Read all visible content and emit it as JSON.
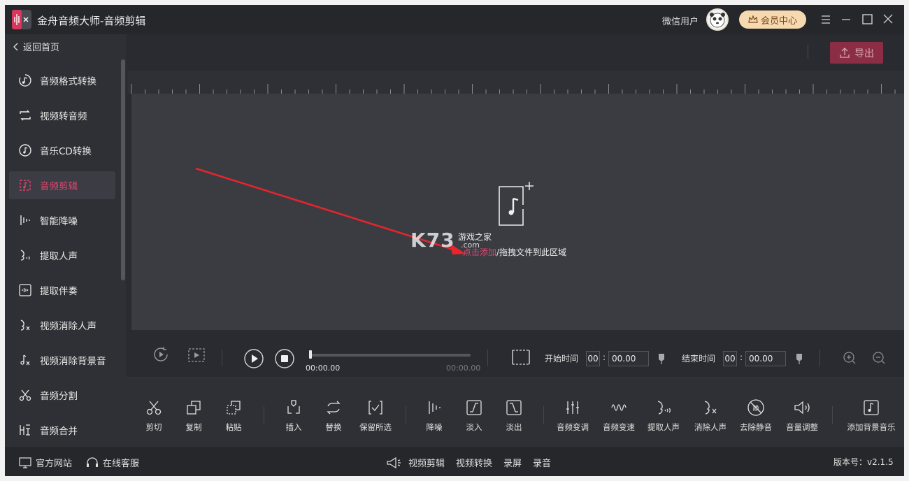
{
  "app": {
    "title": "金舟音频大师-音频剪辑"
  },
  "header": {
    "user_name": "微信用户",
    "vip_label": "会员中心"
  },
  "sidebar": {
    "back_label": "返回首页",
    "items": [
      {
        "label": "音频格式转换",
        "icon": "audio-convert-icon"
      },
      {
        "label": "视频转音频",
        "icon": "video-to-audio-icon"
      },
      {
        "label": "音乐CD转换",
        "icon": "cd-icon"
      },
      {
        "label": "音频剪辑",
        "icon": "audio-edit-icon",
        "active": true
      },
      {
        "label": "智能降噪",
        "icon": "denoise-icon"
      },
      {
        "label": "提取人声",
        "icon": "voice-extract-icon"
      },
      {
        "label": "提取伴奏",
        "icon": "accompaniment-icon"
      },
      {
        "label": "视频消除人声",
        "icon": "video-remove-voice-icon"
      },
      {
        "label": "视频消除背景音",
        "icon": "video-remove-bgm-icon"
      },
      {
        "label": "音频分割",
        "icon": "split-icon"
      },
      {
        "label": "音频合并",
        "icon": "merge-icon"
      }
    ]
  },
  "toolbar": {
    "export_label": "导出"
  },
  "canvas": {
    "add_link": "点击添加",
    "drop_text": "/拖拽文件到此区域",
    "watermark": "K73",
    "watermark_cn": "游戏之家",
    "watermark_com": ".com"
  },
  "playback": {
    "current_time": "00:00.00",
    "total_time": "00:00.00",
    "progress": 0,
    "start_label": "开始时间",
    "start_min": "00",
    "start_sec": "00.00",
    "end_label": "结束时间",
    "end_min": "00",
    "end_sec": "00.00",
    "colon": ":"
  },
  "tools": [
    {
      "label": "剪切",
      "icon": "scissors-icon"
    },
    {
      "label": "复制",
      "icon": "copy-icon"
    },
    {
      "label": "粘贴",
      "icon": "paste-icon"
    },
    {
      "label": "插入",
      "icon": "insert-icon"
    },
    {
      "label": "替换",
      "icon": "replace-icon"
    },
    {
      "label": "保留所选",
      "icon": "keep-selection-icon"
    },
    {
      "label": "降噪",
      "icon": "noise-reduction-icon"
    },
    {
      "label": "淡入",
      "icon": "fade-in-icon"
    },
    {
      "label": "淡出",
      "icon": "fade-out-icon"
    },
    {
      "label": "音频变调",
      "icon": "pitch-icon"
    },
    {
      "label": "音频变速",
      "icon": "speed-icon"
    },
    {
      "label": "提取人声",
      "icon": "extract-voice-icon"
    },
    {
      "label": "消除人声",
      "icon": "remove-voice-icon"
    },
    {
      "label": "去除静音",
      "icon": "remove-silence-icon"
    },
    {
      "label": "音量调整",
      "icon": "volume-icon"
    },
    {
      "label": "添加背景音乐",
      "icon": "add-bgm-icon"
    }
  ],
  "statusbar": {
    "website": "官方网站",
    "service": "在线客服",
    "links": [
      "视频剪辑",
      "视频转换",
      "录屏",
      "录音"
    ],
    "version": "版本号：v2.1.5"
  }
}
